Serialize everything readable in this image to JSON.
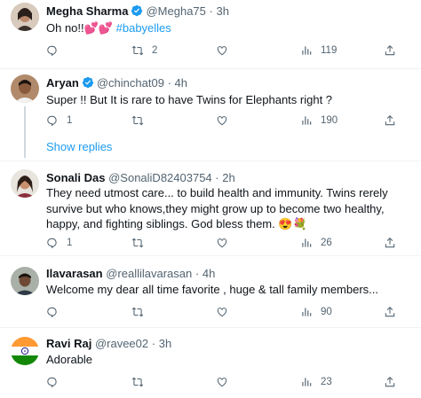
{
  "replies": [
    {
      "name": "Megha Sharma",
      "verified": true,
      "handle": "@Megha75",
      "dot": "·",
      "time": "3h",
      "text_main": "Oh no!!💕💕 ",
      "hashtag": "#babyelles",
      "replies_count": "",
      "retweets": "2",
      "likes": "",
      "views": "119"
    },
    {
      "name": "Aryan",
      "verified": true,
      "handle": "@chinchat09",
      "dot": "·",
      "time": "4h",
      "text_main": "Super !! But It is rare to have Twins for Elephants right ?",
      "replies_count": "1",
      "retweets": "",
      "likes": "",
      "views": "190"
    },
    {
      "name": "Sonali Das",
      "verified": false,
      "handle": "@SonaliD82403754",
      "dot": "·",
      "time": "2h",
      "text_main": "They need utmost care... to build health and immunity. Twins rerely survive but who knows,they might grow up to become two healthy, happy, and fighting siblings. God bless them. 😍💐",
      "replies_count": "1",
      "retweets": "",
      "likes": "",
      "views": "26"
    },
    {
      "name": "Ilavarasan",
      "verified": false,
      "handle": "@reallilavarasan",
      "dot": "·",
      "time": "4h",
      "text_main": "Welcome  my dear all time favorite , huge & tall family members...",
      "replies_count": "",
      "retweets": "",
      "likes": "",
      "views": "90"
    },
    {
      "name": "Ravi Raj",
      "verified": false,
      "handle": "@ravee02",
      "dot": "·",
      "time": "3h",
      "text_main": "Adorable",
      "replies_count": "",
      "retweets": "",
      "likes": "",
      "views": "23"
    }
  ],
  "show_replies": "Show replies",
  "colors": {
    "accent": "#1d9bf0",
    "muted": "#536471",
    "border": "#eff3f4"
  },
  "icons": [
    "reply-icon",
    "retweet-icon",
    "like-icon",
    "views-icon",
    "share-icon",
    "verified-badge-icon"
  ]
}
